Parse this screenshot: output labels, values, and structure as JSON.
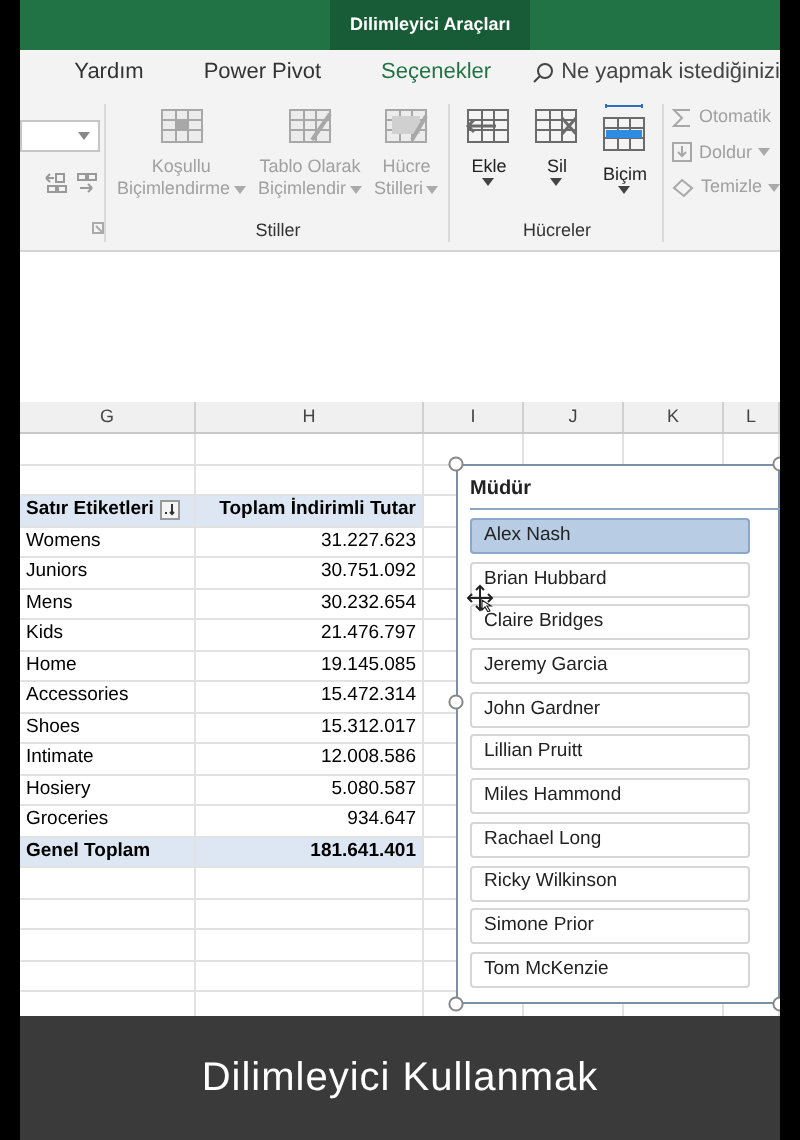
{
  "context_tab": "Dilimleyici Araçları",
  "tabs": [
    {
      "label": "Yardım",
      "selected": false
    },
    {
      "label": "Power Pivot",
      "selected": false
    },
    {
      "label": "Seçenekler",
      "selected": true
    }
  ],
  "tell_me": {
    "placeholder": "Ne yapmak istediğinizi"
  },
  "ribbon": {
    "groups": [
      {
        "label": "Stiller",
        "buttons": [
          {
            "kind": "conditional",
            "lines": [
              "Koşullu",
              "Biçimlendirme"
            ],
            "disabled": true
          },
          {
            "kind": "table",
            "lines": [
              "Tablo Olarak",
              "Biçimlendir"
            ],
            "disabled": true
          },
          {
            "kind": "cellstyle",
            "lines": [
              "Hücre",
              "Stilleri"
            ],
            "disabled": true
          }
        ]
      },
      {
        "label": "Hücreler",
        "buttons": [
          {
            "kind": "insert",
            "lines": [
              "Ekle"
            ],
            "disabled": false
          },
          {
            "kind": "delete",
            "lines": [
              "Sil"
            ],
            "disabled": false
          },
          {
            "kind": "format",
            "lines": [
              "Biçim"
            ],
            "disabled": false
          }
        ]
      }
    ],
    "editing": [
      {
        "kind": "sum",
        "label": "Otomatik",
        "disabled": true
      },
      {
        "kind": "fill",
        "label": "Doldur",
        "disabled": true
      },
      {
        "kind": "clear",
        "label": "Temizle",
        "disabled": true
      }
    ]
  },
  "columns": [
    "G",
    "H",
    "I",
    "J",
    "K",
    "L"
  ],
  "pivot": {
    "header": [
      "Satır Etiketleri",
      "Toplam İndirimli Tutar"
    ],
    "rows": [
      {
        "label": "Womens",
        "value": "31.227.623"
      },
      {
        "label": "Juniors",
        "value": "30.751.092"
      },
      {
        "label": "Mens",
        "value": "30.232.654"
      },
      {
        "label": "Kids",
        "value": "21.476.797"
      },
      {
        "label": "Home",
        "value": "19.145.085"
      },
      {
        "label": "Accessories",
        "value": "15.472.314"
      },
      {
        "label": "Shoes",
        "value": "15.312.017"
      },
      {
        "label": "Intimate",
        "value": "12.008.586"
      },
      {
        "label": "Hosiery",
        "value": "5.080.587"
      },
      {
        "label": "Groceries",
        "value": "934.647"
      }
    ],
    "total": {
      "label": "Genel Toplam",
      "value": "181.641.401"
    }
  },
  "slicer": {
    "title": "Müdür",
    "items": [
      {
        "label": "Alex Nash",
        "selected": true
      },
      {
        "label": "Brian Hubbard",
        "selected": false
      },
      {
        "label": "Claire Bridges",
        "selected": false
      },
      {
        "label": "Jeremy Garcia",
        "selected": false
      },
      {
        "label": "John Gardner",
        "selected": false
      },
      {
        "label": "Lillian Pruitt",
        "selected": false
      },
      {
        "label": "Miles Hammond",
        "selected": false
      },
      {
        "label": "Rachael Long",
        "selected": false
      },
      {
        "label": "Ricky Wilkinson",
        "selected": false
      },
      {
        "label": "Simone Prior",
        "selected": false
      },
      {
        "label": "Tom McKenzie",
        "selected": false
      }
    ]
  },
  "caption": "Dilimleyici Kullanmak"
}
